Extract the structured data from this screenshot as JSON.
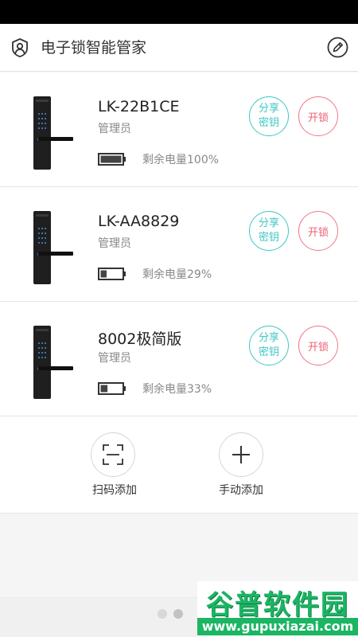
{
  "header": {
    "title": "电子锁智能管家",
    "user_icon": "user-icon",
    "edit_icon": "edit-icon"
  },
  "locks": [
    {
      "name": "LK-22B1CE",
      "role": "管理员",
      "battery_text": "剩余电量100%",
      "battery_level": 1.0,
      "share_label": "分享\n密钥",
      "unlock_label": "开锁"
    },
    {
      "name": "LK-AA8829",
      "role": "管理员",
      "battery_text": "剩余电量29%",
      "battery_level": 0.29,
      "share_label": "分享\n密钥",
      "unlock_label": "开锁"
    },
    {
      "name": "8002极简版",
      "role": "管理员",
      "battery_text": "剩余电量33%",
      "battery_level": 0.33,
      "share_label": "分享\n密钥",
      "unlock_label": "开锁"
    }
  ],
  "add": {
    "scan_label": "扫码添加",
    "manual_label": "手动添加"
  },
  "pager": {
    "count": 2,
    "active_index": 1
  },
  "watermark": {
    "title": "谷普软件园",
    "url": "www.gupuxiazai.com"
  },
  "colors": {
    "share_accent": "#3cc7c5",
    "unlock_accent": "#ee5f74",
    "watermark_green": "#1bb564"
  }
}
